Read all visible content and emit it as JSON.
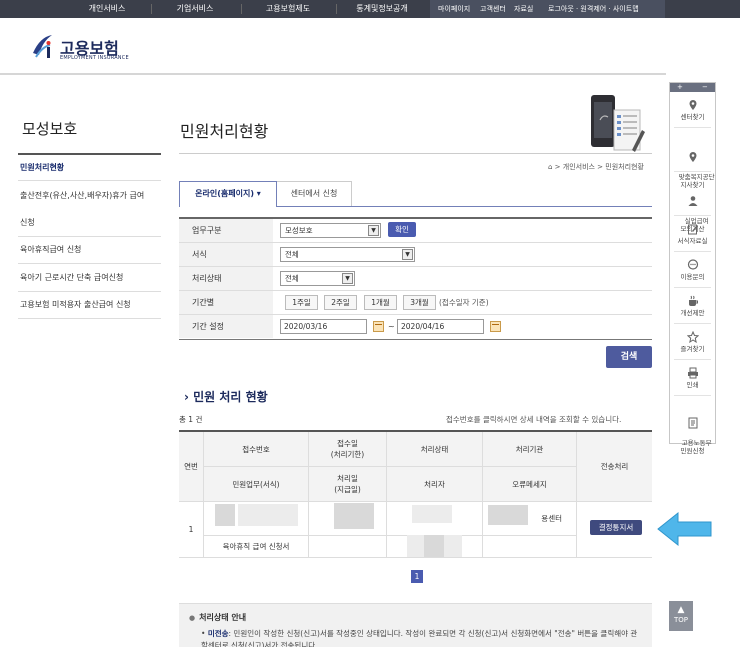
{
  "topnav": {
    "items": [
      "개인서비스",
      "기업서비스",
      "고용보험제도",
      "통계및정보공개"
    ],
    "mypage": "마이페이지",
    "center": "고객센터",
    "data_room": "자료실",
    "util": "로그아웃 · 원격제어 · 사이트맵"
  },
  "logo": {
    "name": "고용보험",
    "sub": "EMPLOYMENT INSURANCE"
  },
  "sidebar": {
    "title": "모성보호",
    "items": [
      "민원처리현황",
      "출산전후(유산,사산,배우자)휴가 급여",
      "신청",
      "육아휴직급여 신청",
      "육아기 근로시간 단축 급여신청",
      "고용보험 미적용자 출산급여 신청"
    ]
  },
  "main": {
    "title": "민원처리현황",
    "breadcrumb": "⌂ > 개인서비스 > 민원처리현황",
    "tabs": [
      "온라인(홈페이지) ▾",
      "센터에서 신청"
    ],
    "form": {
      "labels": [
        "업무구분",
        "서식",
        "처리상태",
        "기간별",
        "기간 설정"
      ],
      "biz_type": "모성보호",
      "confirm": "확인",
      "form_type": "전체",
      "status": "전체",
      "periods": [
        "1주일",
        "2주일",
        "1개월",
        "3개월"
      ],
      "period_hint": "(접수일자 기준)",
      "date_from": "2020/03/16",
      "date_to": "2020/04/16",
      "tilde": "~"
    },
    "search": "검색",
    "section_title": "› 민원 처리 현황",
    "count": "총 1 건",
    "tip": "접수번호를 클릭하시면 상세 내역을 조회할 수 있습니다.",
    "table": {
      "headers": {
        "no": "연번",
        "receipt_no": "접수번호",
        "receipt_date": "접수일\n(처리기한)",
        "status": "처리상태",
        "agency": "처리기관",
        "send": "전송처리",
        "civil_form": "민원업무(서식)",
        "proc_date": "처리일\n(지급일)",
        "handler": "처리자",
        "error": "오류메세지"
      },
      "row": {
        "no": "1",
        "agency_suffix": "용센터",
        "notice_button": "결정통지서",
        "form_name": "육아휴직 급여 신청서"
      }
    },
    "page": "1",
    "info": {
      "title": "처리상태 안내",
      "term": "미전송",
      "text": ": 민원인이 작성한 신청(신고)서를 작성중인 상태입니다. 작성이 완료되면 각 신청(신고)서 신청화면에서 \"전송\" 버튼을 클릭해야 관할센터로 신청(신고)서가 전송됩니다."
    }
  },
  "quick": {
    "items": [
      "센터찾기",
      "맞춤복지공단\n지사찾기",
      "실업급여\n모의계산",
      "서식자료실",
      "이용문의",
      "개선제안",
      "즐겨찾기",
      "인쇄",
      "고용노동부\n민원신청"
    ],
    "top": "TOP"
  }
}
